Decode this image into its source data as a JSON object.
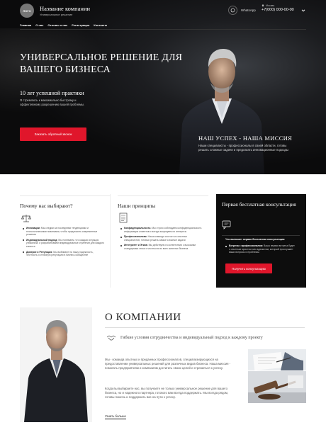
{
  "header": {
    "logo_text": "ЛОГО",
    "company_name": "Название компании",
    "tagline": "Универсальное решение",
    "whatsapp_label": "WhatsApp",
    "city": "Москва",
    "phone": "+7(000) 000-00-00"
  },
  "nav": {
    "items": [
      "Главная",
      "О нас",
      "Отзывы о нас",
      "Регистрация",
      "Контакты"
    ]
  },
  "hero": {
    "title": "УНИВЕРСАЛЬНОЕ РЕШЕНИЕ ДЛЯ ВАШЕГО БИЗНЕСА",
    "years": "10 лет успешной практики",
    "description": "Я стремлюсь к максимально быстрому и эффективному разрешению вашей проблемы.",
    "button": "Заказать обратный звонок",
    "mission_title": "НАШ УСПЕХ - НАША МИССИЯ",
    "mission_text": "Наши специалисты - профессионалы в своей области, готовы решать сложные задачи и предлагать инновационные подходы"
  },
  "why": {
    "title": "Почему нас выбирают?",
    "items": [
      {
        "bold": "Инновации:",
        "text": "Мы следим за последними тенденциями и технологическими новинками, чтобы предложить современные решения"
      },
      {
        "bold": "Индивидуальный подход:",
        "text": "Мы понимаем, что каждая ситуация уникальна, и разрабатываем индивидуальные стратегии для каждого клиента"
      },
      {
        "bold": "Доверие и Репутация:",
        "text": "Мы выбивают на нашу надежность, честность и отличную репутацию в бизнес-сообществе"
      }
    ]
  },
  "principles": {
    "title": "Наши принципы",
    "items": [
      {
        "bold": "Конфиденциальность:",
        "text": "Мы строго соблюдаем конфиденциальность информации клиентов и всегда защищаем их интересы"
      },
      {
        "bold": "Профессионализм:",
        "text": "Наша команда состоит из опытных специалистов, готовых решать самые сложные задачи"
      },
      {
        "bold": "Интегритет и Этика:",
        "text": "Мы действуем в соответствии с высокими стандартами этики и честности во всех аспектах бизнеса"
      }
    ]
  },
  "consult": {
    "title": "Первая бесплатная консультация",
    "question": "Что включает первая бесплатная консультация:",
    "item_bold": "Встреча с профессионалом:",
    "item_text": "Ваша первая встреча будет с опытным юристом или адвокатом, который прослушает ваши вопросы и проблемы.",
    "button": "Получить консультацию"
  },
  "about": {
    "title": "О КОМПАНИИ",
    "subtitle": "Гибкие условия сотрудничества и индивидуальный подход к каждому проекту",
    "p1": "Мы - команда опытных и преданных профессионалов, специализирующихся на предоставлении универсальных решений для различных видов бизнеса. Наша миссия - помогать предприятиям и компаниям достигать своих целей и стремиться к успеху.",
    "p2": "Когда вы выбираете нас, вы получаете не только универсальное решение для вашего бизнеса, но и надежного партнера, готового вам всегда поддержать. Мы всегда рядом, готовы помочь и поддержать вас на пути к успеху.",
    "read_more": "Узнать больше"
  },
  "colors": {
    "accent": "#e0162b",
    "dark": "#0d0d0d"
  }
}
